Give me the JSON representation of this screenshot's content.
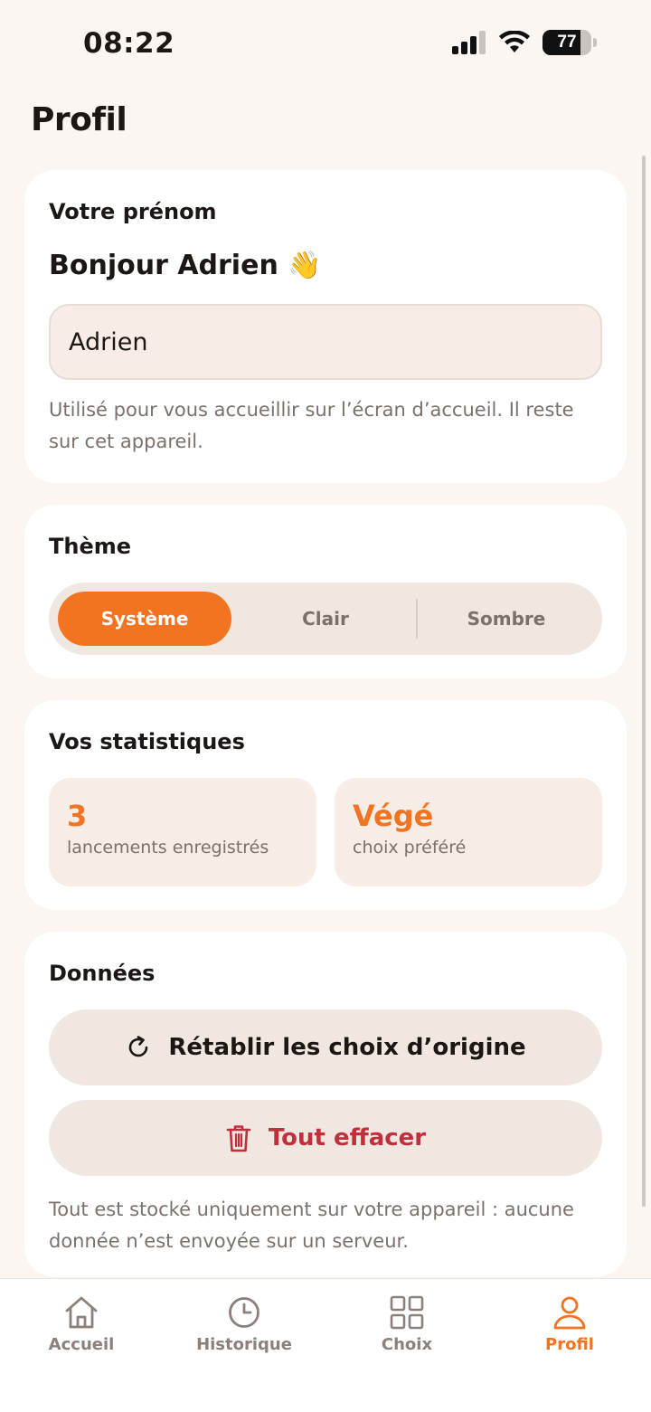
{
  "status": {
    "time": "08:22",
    "battery": "77",
    "battery_level": 0.77
  },
  "page": {
    "title": "Profil"
  },
  "name_card": {
    "title": "Votre prénom",
    "greeting": "Bonjour Adrien",
    "greeting_emoji": "👋",
    "input_value": "Adrien",
    "helper": "Utilisé pour vous accueillir sur l’écran d’accueil. Il reste sur cet appareil."
  },
  "theme_card": {
    "title": "Thème",
    "options": [
      "Système",
      "Clair",
      "Sombre"
    ],
    "selected": "Système"
  },
  "stats_card": {
    "title": "Vos statistiques",
    "tiles": [
      {
        "value": "3",
        "label": "lancements enregistrés"
      },
      {
        "value": "Végé",
        "label": "choix préféré"
      }
    ]
  },
  "data_card": {
    "title": "Données",
    "reset_label": "Rétablir les choix d’origine",
    "clear_label": "Tout effacer",
    "footnote": "Tout est stocké uniquement sur votre appareil : aucune donnée n’est envoyée sur un serveur."
  },
  "tabs": [
    {
      "label": "Accueil",
      "icon": "home-icon"
    },
    {
      "label": "Historique",
      "icon": "clock-icon"
    },
    {
      "label": "Choix",
      "icon": "grid-icon"
    },
    {
      "label": "Profil",
      "icon": "user-icon"
    }
  ],
  "active_tab": "Profil",
  "colors": {
    "accent": "#f27420",
    "danger": "#c0303c",
    "background": "#fbf6f2",
    "card": "#ffffff",
    "tile": "#f7ece6",
    "muted_text": "#7c716a"
  }
}
